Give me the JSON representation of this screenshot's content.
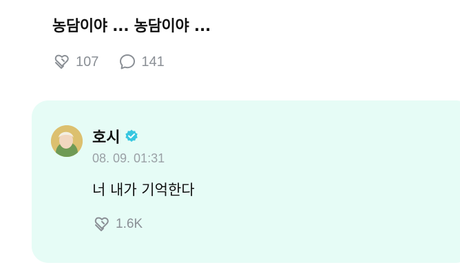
{
  "post": {
    "text": "농담이야 ... 농담이야 ...",
    "likes": "107",
    "comments": "141"
  },
  "reply": {
    "author": "호시",
    "verified": true,
    "timestamp": "08. 09. 01:31",
    "text": "너 내가 기억한다",
    "likes": "1.6K"
  },
  "colors": {
    "card_background": "#e6fcf6",
    "verified_badge": "#37c7e0",
    "muted_text": "#8a8f95"
  },
  "icons": {
    "like": "heart-hands-icon",
    "comment": "speech-bubble-icon",
    "verified": "verified-badge-icon"
  }
}
